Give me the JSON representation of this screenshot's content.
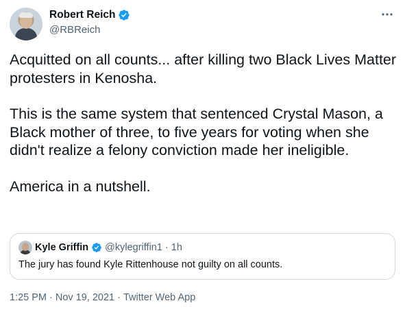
{
  "author": {
    "name": "Robert Reich",
    "handle": "@RBReich",
    "verified": true
  },
  "tweet": {
    "paragraphs": [
      "Acquitted on all counts... after killing two Black Lives Matter protesters in Kenosha.",
      "This is the same system that sentenced Crystal Mason, a Black mother of three, to five years for voting when she didn't realize a felony conviction made her ineligible.",
      "America in a nutshell."
    ]
  },
  "quote": {
    "name": "Kyle Griffin",
    "handle": "@kylegriffin1",
    "separator": "·",
    "time": "1h",
    "verified": true,
    "text": "The jury has found Kyle Rittenhouse not guilty on all counts."
  },
  "meta": {
    "time": "1:25 PM",
    "sep1": "·",
    "date": "Nov 19, 2021",
    "sep2": "·",
    "source": "Twitter Web App"
  },
  "icons": {
    "verified": "verified-badge-icon",
    "more": "more-options-icon"
  },
  "colors": {
    "text": "#0f1419",
    "secondary": "#536471",
    "verified": "#1d9bf0",
    "border": "#cfd9de"
  }
}
